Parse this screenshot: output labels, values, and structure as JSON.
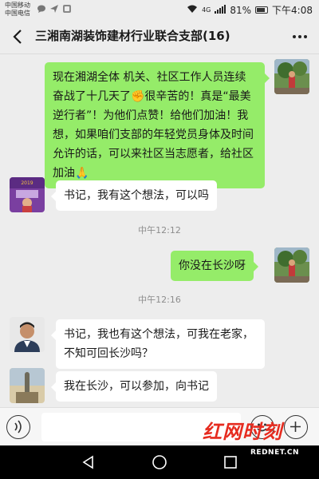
{
  "status_bar": {
    "carrier_1": "中国移动",
    "carrier_2": "中国电信",
    "network": "4G",
    "battery": "81%",
    "time": "下午4:08"
  },
  "chat": {
    "title": "三湘南湖装饰建材行业联合支部(16)"
  },
  "messages": [
    {
      "side": "right",
      "text": "现在湘湖全体 机关、社区工作人员连续奋战了十几天了✊很辛苦的！真是“最美逆行者”！为他们点赞！给他们加油！我想，如果咱们支部的年轻党员身体及时间允许的话，可以来社区当志愿者，给社区加油🙏"
    },
    {
      "side": "left",
      "text": "书记，我有这个想法，可以吗"
    },
    {
      "type": "time",
      "text": "中午12:12"
    },
    {
      "side": "right",
      "text": "你没在长沙呀"
    },
    {
      "type": "time",
      "text": "中午12:16"
    },
    {
      "side": "left",
      "text": "书记，我也有这个想法，可我在老家，不知可回长沙吗？"
    },
    {
      "side": "left",
      "text": "我在长沙，可以参加，向书记"
    }
  ],
  "watermark": {
    "brand": "红网时刻",
    "url": "REDNET.CN"
  },
  "colors": {
    "bubble_right": "#95ec69",
    "bubble_left": "#ffffff",
    "background": "#ededed",
    "watermark_red": "#e62b1f"
  }
}
